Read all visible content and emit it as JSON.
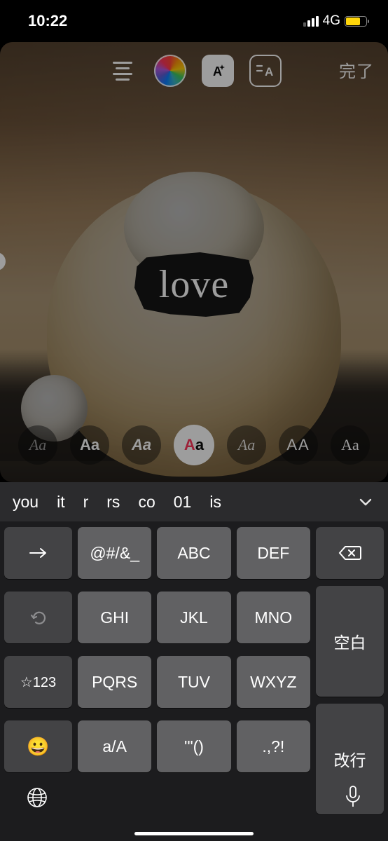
{
  "status": {
    "time": "10:22",
    "network": "4G"
  },
  "toolbar": {
    "done_label": "完了",
    "effects_label": "A",
    "bg_label": "A"
  },
  "text_element": {
    "value": "love"
  },
  "font_styles": [
    "Aa",
    "Aa",
    "Aa",
    "Aa",
    "Aa",
    "AA",
    "Aa"
  ],
  "suggestions": [
    "you",
    "it",
    "r",
    "rs",
    "co",
    "01",
    "is"
  ],
  "keyboard": {
    "row1": [
      "→",
      "@#/&_",
      "ABC",
      "DEF"
    ],
    "delete": "⌫",
    "row2": [
      "↺",
      "GHI",
      "JKL",
      "MNO"
    ],
    "space": "空白",
    "row3": [
      "☆123",
      "PQRS",
      "TUV",
      "WXYZ"
    ],
    "return": "改行",
    "row4": [
      "😀",
      "a/A",
      "'\"()",
      ".,?!"
    ]
  }
}
